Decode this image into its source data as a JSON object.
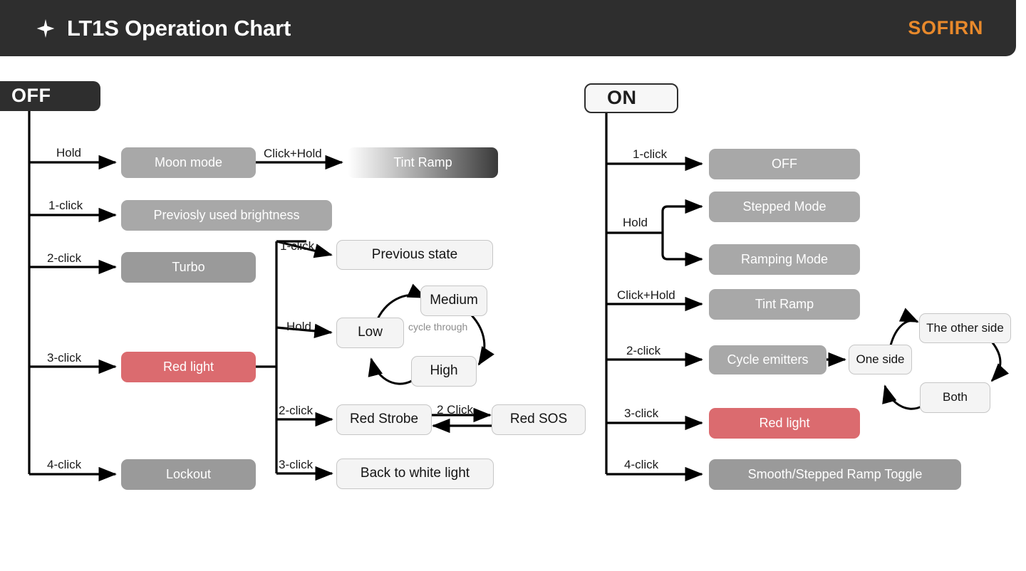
{
  "header": {
    "icon": "sparkle-icon",
    "title": "LT1S Operation Chart",
    "brand": "SOFIRN",
    "bg_color": "#2E2E2E",
    "brand_color": "#E8892B"
  },
  "colors": {
    "gray_box": "#A8A8A8",
    "red_box": "#DB6B6F",
    "light_box": "#F4F4F4",
    "dark": "#2E2E2E",
    "muted_text": "#8C8C8C"
  },
  "chart_data": {
    "type": "diagram",
    "title": "LT1S Operation Chart",
    "columns": [
      {
        "root": "OFF",
        "transitions": [
          {
            "label": "Hold",
            "target": "Moon mode"
          },
          {
            "label": "1-click",
            "target": "Previosly used brightness"
          },
          {
            "label": "2-click",
            "target": "Turbo"
          },
          {
            "label": "3-click",
            "target": "Red light"
          },
          {
            "label": "4-click",
            "target": "Lockout"
          }
        ],
        "sub_transitions": [
          {
            "from": "Moon mode",
            "label": "Click+Hold",
            "target": "Tint Ramp"
          },
          {
            "from": "Red light",
            "label": "1-click",
            "target": "Previous state"
          },
          {
            "from": "Red light",
            "label": "Hold",
            "target": "Low"
          },
          {
            "from": "Red light",
            "label": "2-click",
            "target": "Red Strobe"
          },
          {
            "from": "Red light",
            "label": "3-click",
            "target": "Back to white light"
          },
          {
            "from": "Red Strobe",
            "label": "2 Click",
            "target": "Red SOS",
            "bidirectional": true
          }
        ],
        "cycles": [
          {
            "note": "cycle through",
            "nodes": [
              "Low",
              "Medium",
              "High"
            ]
          }
        ]
      },
      {
        "root": "ON",
        "transitions": [
          {
            "label": "1-click",
            "target": "OFF"
          },
          {
            "label": "Hold",
            "target": [
              "Stepped Mode",
              "Ramping Mode"
            ]
          },
          {
            "label": "Click+Hold",
            "target": "Tint Ramp"
          },
          {
            "label": "2-click",
            "target": "Cycle emitters"
          },
          {
            "label": "3-click",
            "target": "Red light"
          },
          {
            "label": "4-click",
            "target": "Smooth/Stepped Ramp Toggle"
          }
        ],
        "sub_transitions": [
          {
            "from": "Cycle emitters",
            "label": "",
            "target": "One side"
          }
        ],
        "cycles": [
          {
            "note": "",
            "nodes": [
              "One side",
              "The other side",
              "Both"
            ]
          }
        ]
      }
    ]
  },
  "off_column": {
    "root_label": "OFF",
    "labels": {
      "hold": "Hold",
      "one_click": "1-click",
      "two_click": "2-click",
      "three_click": "3-click",
      "four_click": "4-click",
      "click_hold": "Click+Hold",
      "red_one_click": "1-click",
      "red_hold": "Hold",
      "red_two_click": "2-click",
      "red_three_click": "3-click",
      "strobe_two_click": "2 Click",
      "cycle_through": "cycle through"
    },
    "nodes": {
      "moon_mode": "Moon mode",
      "tint_ramp": "Tint Ramp",
      "previously_used": "Previosly used brightness",
      "turbo": "Turbo",
      "red_light": "Red light",
      "lockout": "Lockout",
      "previous_state": "Previous state",
      "low": "Low",
      "medium": "Medium",
      "high": "High",
      "red_strobe": "Red Strobe",
      "red_sos": "Red SOS",
      "back_to_white": "Back to white light"
    }
  },
  "on_column": {
    "root_label": "ON",
    "labels": {
      "one_click": "1-click",
      "hold": "Hold",
      "click_hold": "Click+Hold",
      "two_click": "2-click",
      "three_click": "3-click",
      "four_click": "4-click"
    },
    "nodes": {
      "off": "OFF",
      "stepped_mode": "Stepped Mode",
      "ramping_mode": "Ramping Mode",
      "tint_ramp": "Tint Ramp",
      "cycle_emitters": "Cycle emitters",
      "one_side": "One side",
      "other_side": "The other side",
      "both": "Both",
      "red_light": "Red light",
      "ramp_toggle": "Smooth/Stepped Ramp Toggle"
    }
  }
}
